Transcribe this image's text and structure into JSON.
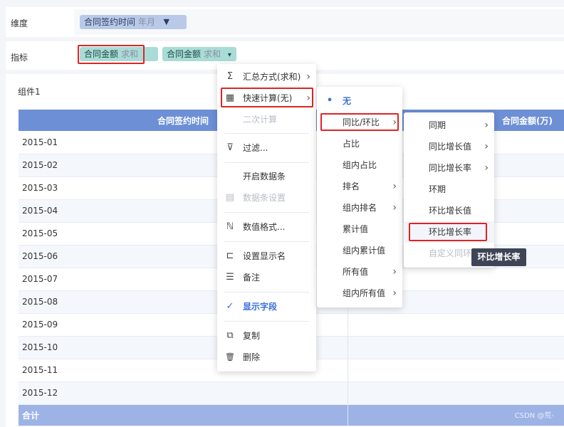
{
  "dimension": {
    "label": "维度",
    "pill_name": "合同签约时间",
    "pill_granularity": "年月",
    "filter_icon": "funnel-icon"
  },
  "indicator": {
    "label": "指标",
    "pill1_name": "合同金额",
    "pill1_agg": "求和",
    "pill2_name": "合同金额",
    "pill2_agg": "求和",
    "pill2_arrow": "▾"
  },
  "component": {
    "title": "组件1"
  },
  "table": {
    "headers": [
      "合同签约时间",
      "合同金额(万)"
    ],
    "rows": [
      "2015-01",
      "2015-02",
      "2015-03",
      "2015-04",
      "2015-05",
      "2015-06",
      "2015-07",
      "2015-08",
      "2015-09",
      "2015-10",
      "2015-11",
      "2015-12"
    ],
    "total_label": "合计"
  },
  "menu1": {
    "items": [
      {
        "icon": "Σ",
        "label": "汇总方式(求和)",
        "chevron": "›"
      },
      {
        "icon": "▦",
        "label": "快速计算(无)",
        "chevron": "›"
      },
      {
        "icon": "",
        "label": "二次计算"
      },
      {
        "icon": "⊽",
        "label": "过滤..."
      },
      {
        "icon": "",
        "label": "开启数据条"
      },
      {
        "icon": "▤",
        "label": "数据条设置"
      },
      {
        "icon": "ℕ",
        "label": "数值格式..."
      },
      {
        "icon": "⊏",
        "label": "设置显示名"
      },
      {
        "icon": "☰",
        "label": "备注"
      },
      {
        "icon": "✓",
        "label": "显示字段"
      },
      {
        "icon": "⧉",
        "label": "复制"
      },
      {
        "icon": "🗑",
        "label": "删除"
      }
    ]
  },
  "menu2": {
    "items": [
      {
        "icon": "•",
        "label": "无"
      },
      {
        "label": "同比/环比",
        "chevron": "›"
      },
      {
        "label": "占比"
      },
      {
        "label": "组内占比"
      },
      {
        "label": "排名",
        "chevron": "›"
      },
      {
        "label": "组内排名",
        "chevron": "›"
      },
      {
        "label": "累计值"
      },
      {
        "label": "组内累计值"
      },
      {
        "label": "所有值",
        "chevron": "›"
      },
      {
        "label": "组内所有值",
        "chevron": "›"
      }
    ]
  },
  "menu3": {
    "items": [
      {
        "label": "同期",
        "chevron": "›"
      },
      {
        "label": "同比增长值",
        "chevron": "›"
      },
      {
        "label": "同比增长率",
        "chevron": "›"
      },
      {
        "label": "环期"
      },
      {
        "label": "环比增长值"
      },
      {
        "label": "环比增长率"
      },
      {
        "label": "自定义同环"
      }
    ]
  },
  "tooltip": {
    "text": "环比增长率"
  },
  "watermark": "CSDN @荒-",
  "colors": {
    "accent": "#3b6fd9",
    "header": "#6d8fd6",
    "highlight": "#e02424"
  }
}
